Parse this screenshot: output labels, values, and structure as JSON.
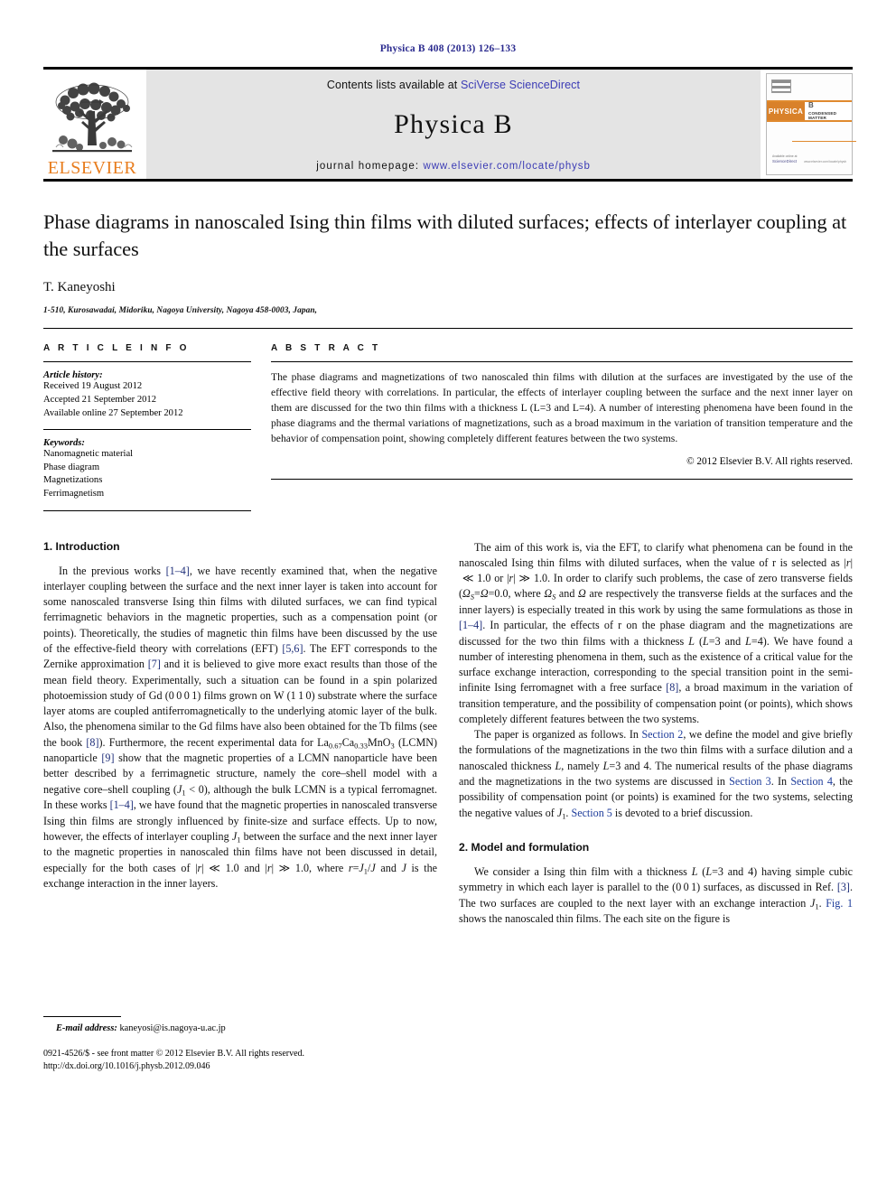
{
  "running_head": "Physica B 408 (2013) 126–133",
  "masthead": {
    "publisher_wordmark": "ELSEVIER",
    "contents_prefix": "Contents lists available at ",
    "contents_link": "SciVerse ScienceDirect",
    "journal_name": "Physica B",
    "homepage_prefix": "journal homepage: ",
    "homepage_link": "www.elsevier.com/locate/physb",
    "accent_orange": "#E87D1E",
    "link_blue": "#3b3bb5",
    "banner_gray": "#e4e4e4",
    "cover": {
      "title": "PHYSICA",
      "volume_letter": "B",
      "subtitle": "CONDENSED MATTER",
      "sciencedirect": "ScienceDirect",
      "sciencedirect_tiny": "Available online at",
      "url": "www.elsevier.com/locate/physb"
    }
  },
  "article": {
    "title": "Phase diagrams in nanoscaled Ising thin films with diluted surfaces; effects of interlayer coupling at the surfaces",
    "authors": "T. Kaneyoshi",
    "affiliation": "1-510, Kurosawadai, Midoriku, Nagoya University, Nagoya 458-0003, Japan,"
  },
  "info": {
    "label": "A R T I C L E   I N F O",
    "history_label": "Article history:",
    "history": [
      "Received 19 August 2012",
      "Accepted 21 September 2012",
      "Available online 27 September 2012"
    ],
    "keywords_label": "Keywords:",
    "keywords": [
      "Nanomagnetic material",
      "Phase diagram",
      "Magnetizations",
      "Ferrimagnetism"
    ]
  },
  "abstract": {
    "label": "A B S T R A C T",
    "text": "The phase diagrams and magnetizations of two nanoscaled thin films with dilution at the surfaces are investigated by the use of the effective field theory with correlations. In particular, the effects of interlayer coupling between the surface and the next inner layer on them are discussed for the two thin films with a thickness L (L=3 and L=4). A number of interesting phenomena have been found in the phase diagrams and the thermal variations of magnetizations, such as a broad maximum in the variation of transition temperature and the behavior of compensation point, showing completely different features between the two systems.",
    "copyright": "© 2012 Elsevier B.V. All rights reserved."
  },
  "sections": {
    "intro_heading": "1.  Introduction",
    "model_heading": "2.  Model and formulation"
  },
  "footnote": {
    "email_label": "E-mail address:",
    "email": "kaneyosi@is.nagoya-u.ac.jp",
    "issn_line": "0921-4526/$ - see front matter © 2012 Elsevier B.V. All rights reserved.",
    "doi_line": "http://dx.doi.org/10.1016/j.physb.2012.09.046"
  }
}
